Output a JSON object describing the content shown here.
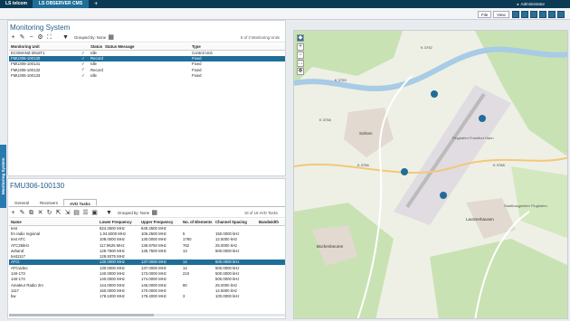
{
  "titlebar": {
    "logo": "LS telcom",
    "active_tab": "LS OBSERVER CMS",
    "new_tab": "+",
    "user": "Administrator"
  },
  "toolbar2": {
    "file": "File",
    "view": "View"
  },
  "side_tab": "Monitoring System",
  "monitoring": {
    "title": "Monitoring System",
    "grouped_by": "Grouped by: None",
    "count_label": "5 of 3 Monitoring Units",
    "columns": [
      "Monitoring Unit",
      "",
      "Status",
      "Status Message",
      "Type"
    ],
    "rows": [
      {
        "unit": "ECGMANZ-3916T1",
        "check": "✓",
        "status": "Idle",
        "message": "",
        "type": "Control Unit",
        "selected": false
      },
      {
        "unit": "FMU306-100130",
        "check": "✓",
        "status": "Recording",
        "message": "",
        "type": "Fixed",
        "selected": true
      },
      {
        "unit": "FMU306-100131",
        "check": "✓",
        "status": "Idle",
        "message": "",
        "type": "Fixed",
        "selected": false
      },
      {
        "unit": "FMU306-100132",
        "check": "✓",
        "status": "Recording",
        "message": "",
        "type": "Fixed",
        "selected": false
      },
      {
        "unit": "FMU306-100133",
        "check": "✓",
        "status": "Idle",
        "message": "",
        "type": "Fixed",
        "selected": false
      }
    ]
  },
  "unit_panel": {
    "title": "FMU306-100130",
    "tabs": [
      "General",
      "Receivers",
      "AVD Tasks"
    ],
    "active_tab": 2,
    "grouped_by": "Grouped by: None",
    "count_label": "18 of 18 AVD Tasks",
    "columns": [
      "Name",
      "Lower Frequency",
      "Upper Frequency",
      "No. of Elements",
      "Channel Spacing",
      "Bandwidth"
    ],
    "rows": [
      {
        "name": "test",
        "lf": "824.2500 MHz",
        "uf": "849.2500 MHz",
        "n": "",
        "cs": "",
        "bw": "",
        "selected": false
      },
      {
        "name": "fm radio regional",
        "lf": "1.04.5000 MHz",
        "uf": "106.2500 MHz",
        "n": "5",
        "cs": "150.0000 kHz",
        "bw": "",
        "selected": false
      },
      {
        "name": "test ATC",
        "lf": "108.0000 MHz",
        "uf": "130.0000 MHz",
        "n": "1760",
        "cs": "12.5000 kHz",
        "bw": "",
        "selected": false
      },
      {
        "name": "ATC25kHz",
        "lf": "117.9625 MHz",
        "uf": "136.9750 MHz",
        "n": "762",
        "cs": "25.0000 kHz",
        "bw": "",
        "selected": false
      },
      {
        "name": "avband",
        "lf": "129.7500 MHz",
        "uf": "135.7500 MHz",
        "n": "13",
        "cs": "500.0000 kHz",
        "bw": "",
        "selected": false
      },
      {
        "name": "test1117",
        "lf": "129.9375 MHz",
        "uf": "",
        "n": "",
        "cs": "",
        "bw": "",
        "selected": false
      },
      {
        "name": "ATCt",
        "lf": "130.0000 MHz",
        "uf": "137.0000 MHz",
        "n": "14",
        "cs": "500.0000 kHz",
        "bw": "",
        "selected": true
      },
      {
        "name": "ATCvideo",
        "lf": "130.0000 MHz",
        "uf": "137.0000 MHz",
        "n": "14",
        "cs": "500.0000 kHz",
        "bw": "",
        "selected": false
      },
      {
        "name": "140-173",
        "lf": "140.0000 MHz",
        "uf": "173.0000 MHz",
        "n": "210",
        "cs": "500.0000 kHz",
        "bw": "",
        "selected": false
      },
      {
        "name": "140-174",
        "lf": "140.0000 MHz",
        "uf": "174.0000 MHz",
        "n": "",
        "cs": "500.0000 kHz",
        "bw": "",
        "selected": false
      },
      {
        "name": "Amateur Radio 2m",
        "lf": "144.0000 MHz",
        "uf": "146.0000 MHz",
        "n": "80",
        "cs": "25.0000 kHz",
        "bw": "",
        "selected": false
      },
      {
        "name": "1117",
        "lf": "160.0000 MHz",
        "uf": "170.0000 MHz",
        "n": "",
        "cs": "12.5000 kHz",
        "bw": "",
        "selected": false
      },
      {
        "name": "bw",
        "lf": "178.1000 MHz",
        "uf": "178.4000 MHz",
        "n": "3",
        "cs": "100.0000 kHz",
        "bw": "",
        "selected": false
      }
    ]
  },
  "map": {
    "labels": [
      "K 3759",
      "K 3758",
      "K 3756",
      "K 3792",
      "Flughafen Frankfurt Hahn",
      "Stadtbusgeleiter Flughafen",
      "Sohren",
      "Büchenbeuren",
      "Lautzenhausen",
      "K 3788"
    ]
  }
}
